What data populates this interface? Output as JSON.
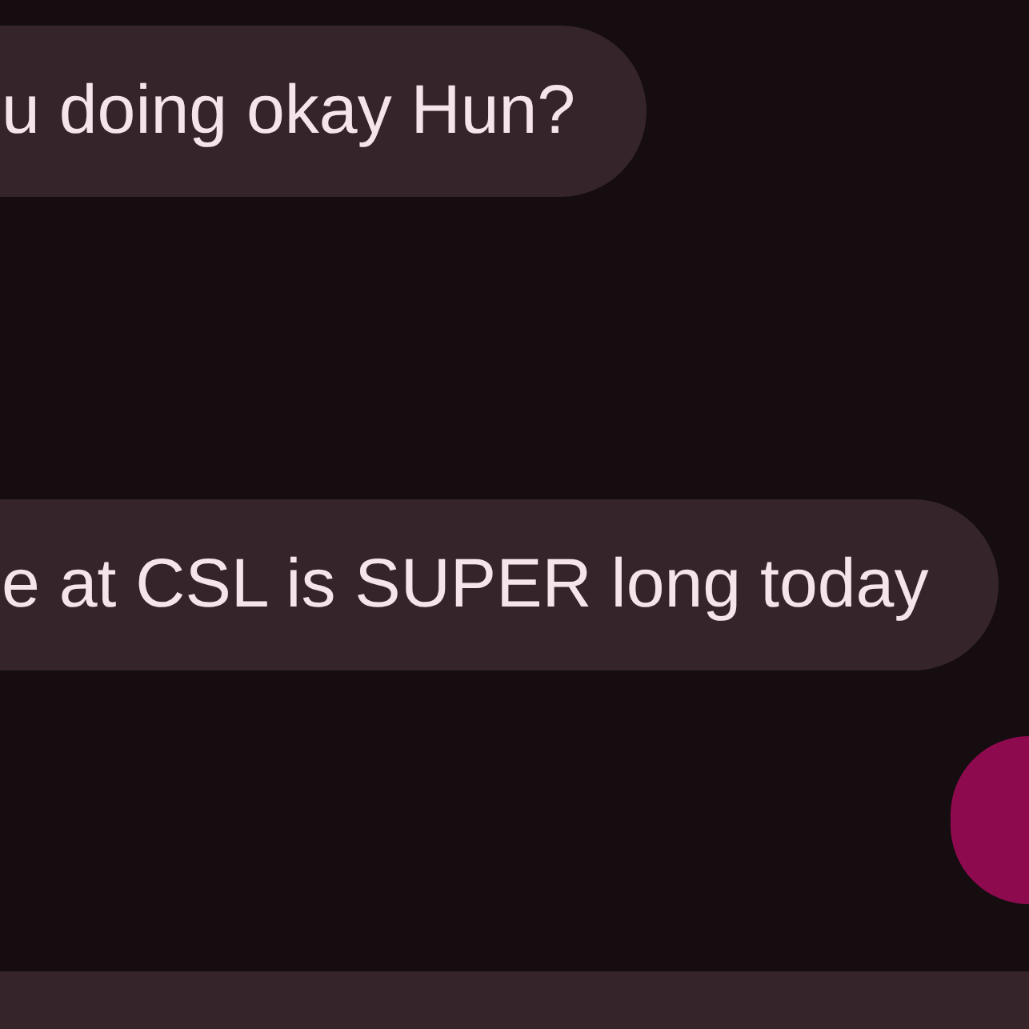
{
  "messages": [
    {
      "kind": "received",
      "text": "u doing okay Hun?"
    },
    {
      "kind": "received",
      "text": "e at CSL is SUPER long today"
    },
    {
      "kind": "sent"
    },
    {
      "kind": "received"
    }
  ]
}
